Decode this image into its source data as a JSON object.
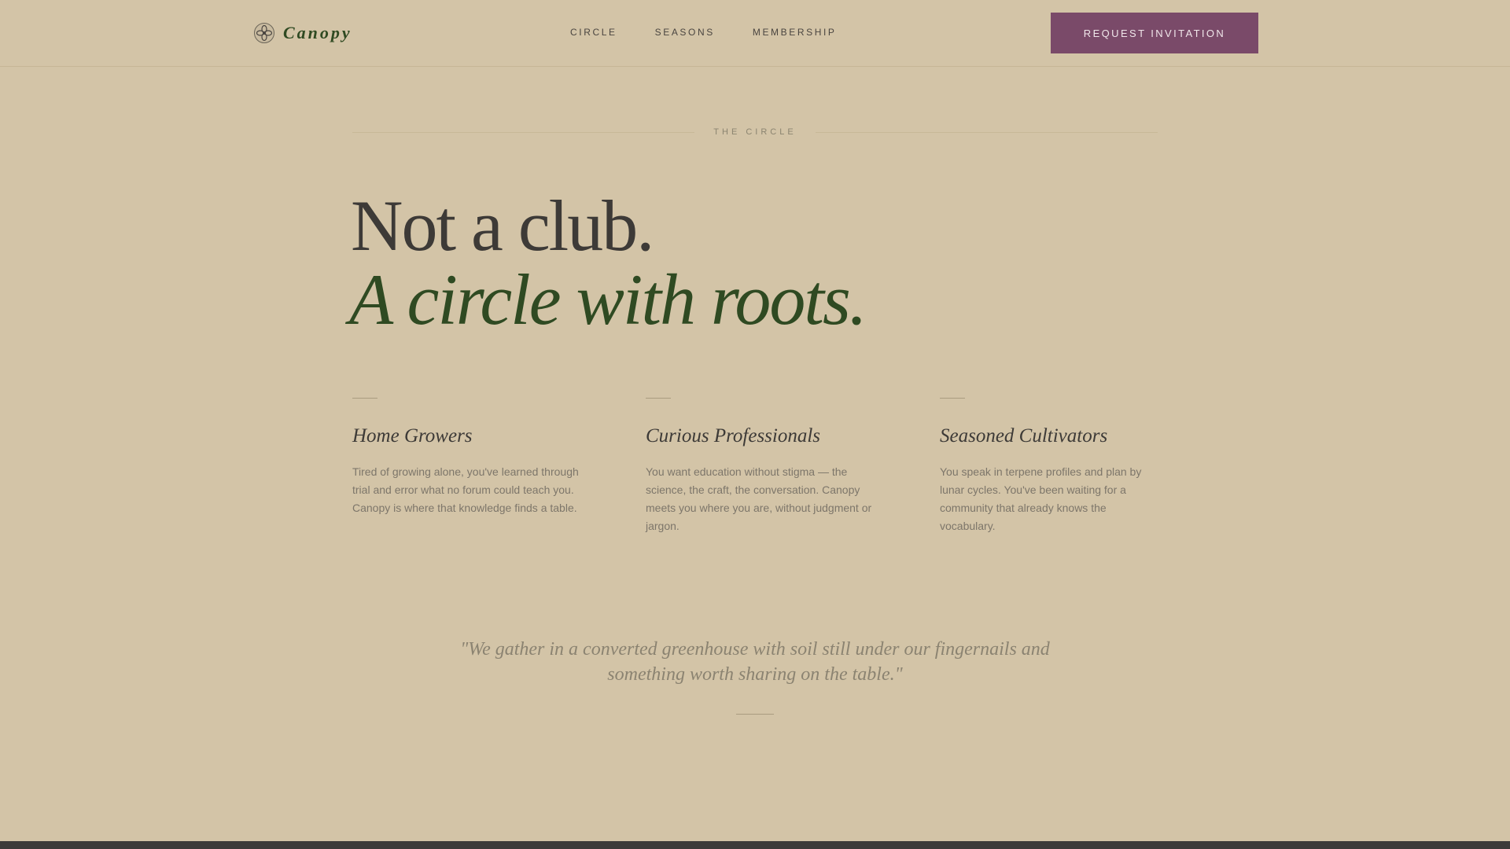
{
  "header": {
    "brand": "Canopy",
    "logo_icon": "flower-emblem-icon",
    "nav": [
      "CIRCLE",
      "SEASONS",
      "MEMBERSHIP"
    ],
    "cta_label": "REQUEST INVITATION"
  },
  "section": {
    "eyebrow": "THE CIRCLE",
    "headline_line1": "Not a club.",
    "headline_line2": "A circle with roots."
  },
  "columns": [
    {
      "title": "Home Growers",
      "body": "Tired of growing alone, you've learned through trial and error what no forum could teach you. Canopy is where that knowledge finds a table."
    },
    {
      "title": "Curious Professionals",
      "body": "You want education without stigma — the science, the craft, the conversation. Canopy meets you where you are, without judgment or jargon."
    },
    {
      "title": "Seasoned Cultivators",
      "body": "You speak in terpene profiles and plan by lunar cycles. You've been waiting for a community that already knows the vocabulary."
    }
  ],
  "quote": "\"We gather in a converted greenhouse with soil still under our fingernails and something worth sharing on the table.\"",
  "colors": {
    "background": "#d3c4a7",
    "accent_green": "#2f4a22",
    "cta_plum": "#7a4a69",
    "text_dark": "#3d3a37"
  }
}
